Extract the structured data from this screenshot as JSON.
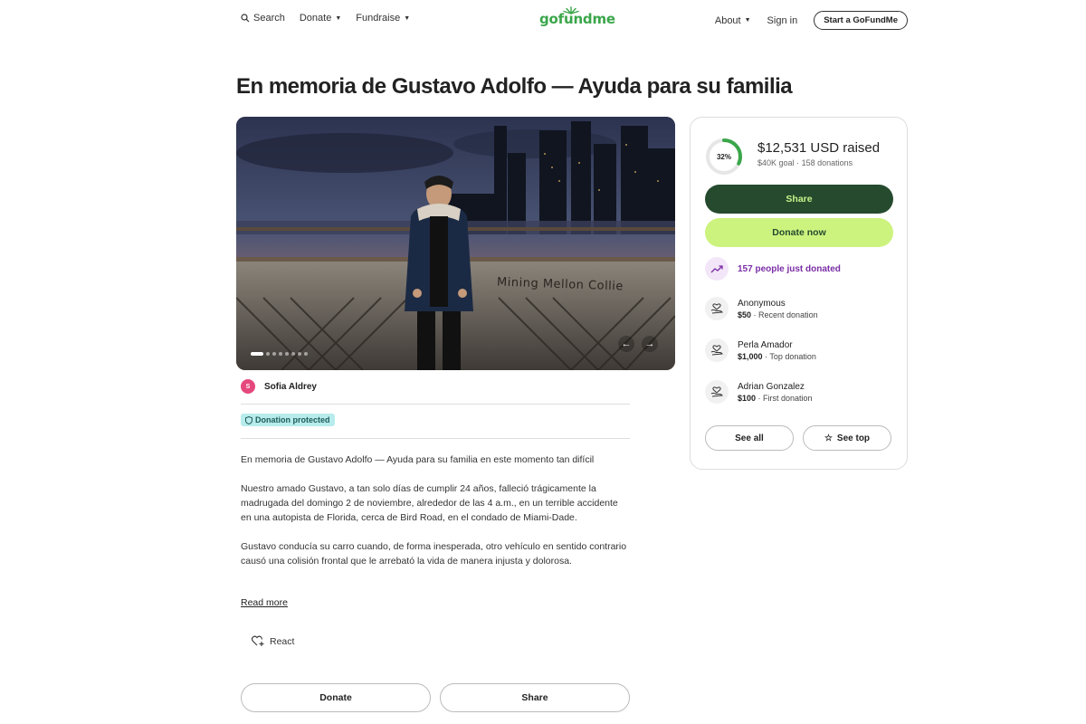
{
  "header": {
    "search_label": "Search",
    "donate_label": "Donate",
    "fundraise_label": "Fundraise",
    "logo_text": "gofundme",
    "about_label": "About",
    "signin_label": "Sign in",
    "start_label": "Start a GoFundMe"
  },
  "page": {
    "title": "En memoria de Gustavo Adolfo — Ayuda para su familia"
  },
  "hero": {
    "wall_text": "Mining Mellon Collie",
    "slide_count": 9,
    "active_slide": 1
  },
  "organizer": {
    "initial": "S",
    "name": "Sofia Aldrey",
    "protected_label": "Donation protected"
  },
  "story": {
    "paragraphs": [
      "En memoria de Gustavo Adolfo — Ayuda para su familia en este momento tan difícil",
      "Nuestro amado Gustavo, a tan solo días de cumplir 24 años, falleció trágicamente la madrugada del domingo 2 de noviembre, alrededor de las 4 a.m., en un terrible accidente en una autopista de Florida, cerca de Bird Road, en el condado de Miami-Dade.",
      "Gustavo conducía su carro cuando, de forma inesperada, otro vehículo en sentido contrario causó una colisión frontal que le arrebató la vida de manera injusta y dolorosa."
    ],
    "read_more": "Read more",
    "react_label": "React",
    "donate_button": "Donate",
    "share_button": "Share"
  },
  "card": {
    "percent": 32,
    "percent_label": "32%",
    "raised": "$12,531 USD raised",
    "goal": "$40K goal",
    "donations": "158 donations",
    "share_label": "Share",
    "donate_label": "Donate now",
    "trend_label": "157 people just donated",
    "donors": [
      {
        "name": "Anonymous",
        "amount": "$50",
        "kind": "Recent donation"
      },
      {
        "name": "Perla Amador",
        "amount": "$1,000",
        "kind": "Top donation"
      },
      {
        "name": "Adrian Gonzalez",
        "amount": "$100",
        "kind": "First donation"
      }
    ],
    "see_all": "See all",
    "see_top": "See top"
  },
  "colors": {
    "brand_green": "#3aa64a",
    "dark_green": "#254a2e",
    "lime": "#cdf37f",
    "purple": "#7a2ea5"
  }
}
